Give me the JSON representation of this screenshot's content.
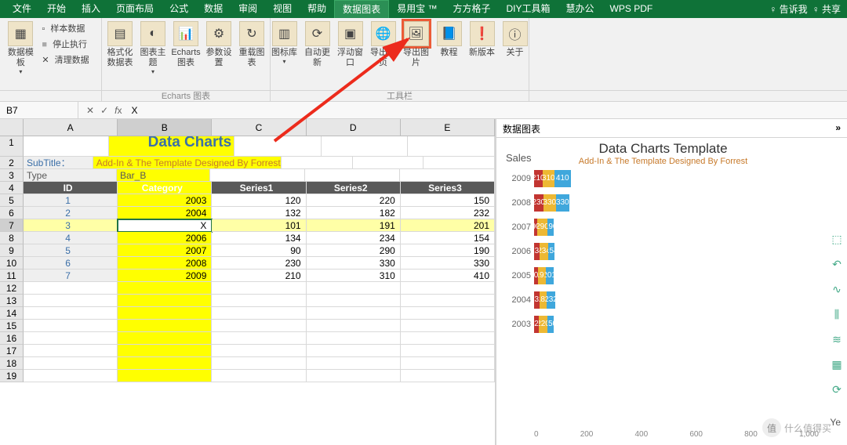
{
  "tabs": [
    "文件",
    "开始",
    "插入",
    "页面布局",
    "公式",
    "数据",
    "审阅",
    "视图",
    "帮助",
    "数据图表",
    "易用宝 ™",
    "方方格子",
    "DIY工具箱",
    "慧办公",
    "WPS PDF"
  ],
  "active_tab_index": 9,
  "right_tabs": {
    "tellme": "告诉我",
    "share": "共享"
  },
  "ribbon": {
    "group1": {
      "big": "数据模板",
      "small": [
        "样本数据",
        "停止执行",
        "清理数据"
      ]
    },
    "group2": {
      "btns": [
        "格式化数据表",
        "图表主题",
        "Echarts图表",
        "参数设置",
        "重载图表"
      ],
      "cap": "Echarts 图表"
    },
    "group3": {
      "btns": [
        "图标库",
        "自动更新",
        "浮动窗口",
        "导出网页",
        "导出图片",
        "教程",
        "新版本",
        "关于"
      ],
      "cap": "工具栏"
    }
  },
  "namebox": "B7",
  "formula": "X",
  "cols": [
    "A",
    "B",
    "C",
    "D",
    "E"
  ],
  "title": "Data Charts Template",
  "subtitle_label": "SubTitle：",
  "subtitle_value": "Add-In & The Template Designed By Forrest",
  "type_label": "Type",
  "type_value": "Bar_B",
  "headers": [
    "ID",
    "Category",
    "Series1",
    "Series2",
    "Series3"
  ],
  "rows": [
    {
      "id": "1",
      "cat": "2003",
      "s1": "120",
      "s2": "220",
      "s3": "150"
    },
    {
      "id": "2",
      "cat": "2004",
      "s1": "132",
      "s2": "182",
      "s3": "232"
    },
    {
      "id": "3",
      "cat": "X",
      "s1": "101",
      "s2": "191",
      "s3": "201"
    },
    {
      "id": "4",
      "cat": "2006",
      "s1": "134",
      "s2": "234",
      "s3": "154"
    },
    {
      "id": "5",
      "cat": "2007",
      "s1": "90",
      "s2": "290",
      "s3": "190"
    },
    {
      "id": "6",
      "cat": "2008",
      "s1": "230",
      "s2": "330",
      "s3": "330"
    },
    {
      "id": "7",
      "cat": "2009",
      "s1": "210",
      "s2": "310",
      "s3": "410"
    }
  ],
  "chartpanel_title": "数据图表",
  "chart_data": {
    "type": "bar",
    "orientation": "horizontal-stacked",
    "title": "Data Charts Template",
    "subtitle": "Add-In & The Template Designed By Forrest",
    "ylabel": "Sales",
    "xlabel": "Ye",
    "categories": [
      "2009",
      "2008",
      "2007",
      "2006",
      "2005",
      "2004",
      "2003"
    ],
    "series": [
      {
        "name": "Series1",
        "color": "#c23531",
        "values": [
          210,
          230,
          90,
          134,
          101,
          132,
          120
        ]
      },
      {
        "name": "Series2",
        "color": "#edb833",
        "values": [
          310,
          330,
          290,
          234,
          191,
          182,
          220
        ]
      },
      {
        "name": "Series3",
        "color": "#3fa7dc",
        "values": [
          410,
          330,
          190,
          154,
          201,
          232,
          150
        ]
      }
    ],
    "xticks": [
      "0",
      "200",
      "400",
      "600",
      "800",
      "1,000"
    ],
    "xmax": 1000,
    "bar_labels": [
      [
        "210",
        "310",
        "410"
      ],
      [
        "230",
        "330",
        "330"
      ],
      [
        "90",
        "290",
        "190"
      ],
      [
        "134",
        "234",
        "154"
      ],
      [
        "101",
        "191",
        "201"
      ],
      [
        "132",
        "182",
        "232"
      ],
      [
        "120",
        "220",
        "150"
      ]
    ]
  },
  "watermark": "什么值得买"
}
